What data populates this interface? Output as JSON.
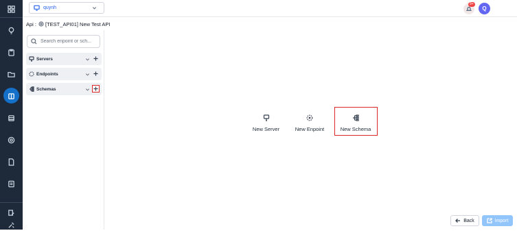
{
  "topbar": {
    "project_name": "quynh",
    "notification_count": "9+",
    "avatar_initial": "Q"
  },
  "breadcrumb": {
    "prefix": "Api :",
    "title": "[TEST_API01] New Test API"
  },
  "left_panel": {
    "search_placeholder": "Search enpoint or sch...",
    "sections": [
      {
        "label": "Servers",
        "icon": "server-icon"
      },
      {
        "label": "Endpoints",
        "icon": "endpoint-icon"
      },
      {
        "label": "Schemas",
        "icon": "schema-icon",
        "add_highlighted": true
      }
    ]
  },
  "main": {
    "actions": [
      {
        "label": "New Server",
        "icon": "server-icon"
      },
      {
        "label": "New Enpoint",
        "icon": "endpoint-icon"
      },
      {
        "label": "New Schema",
        "icon": "schema-icon",
        "highlighted": true
      }
    ]
  },
  "footer": {
    "back_label": "Back",
    "import_label": "Import"
  },
  "colors": {
    "rail": "#1e2a3a",
    "accent": "#1570c9",
    "highlight": "#dc2626",
    "import_button": "#93c5fd"
  }
}
